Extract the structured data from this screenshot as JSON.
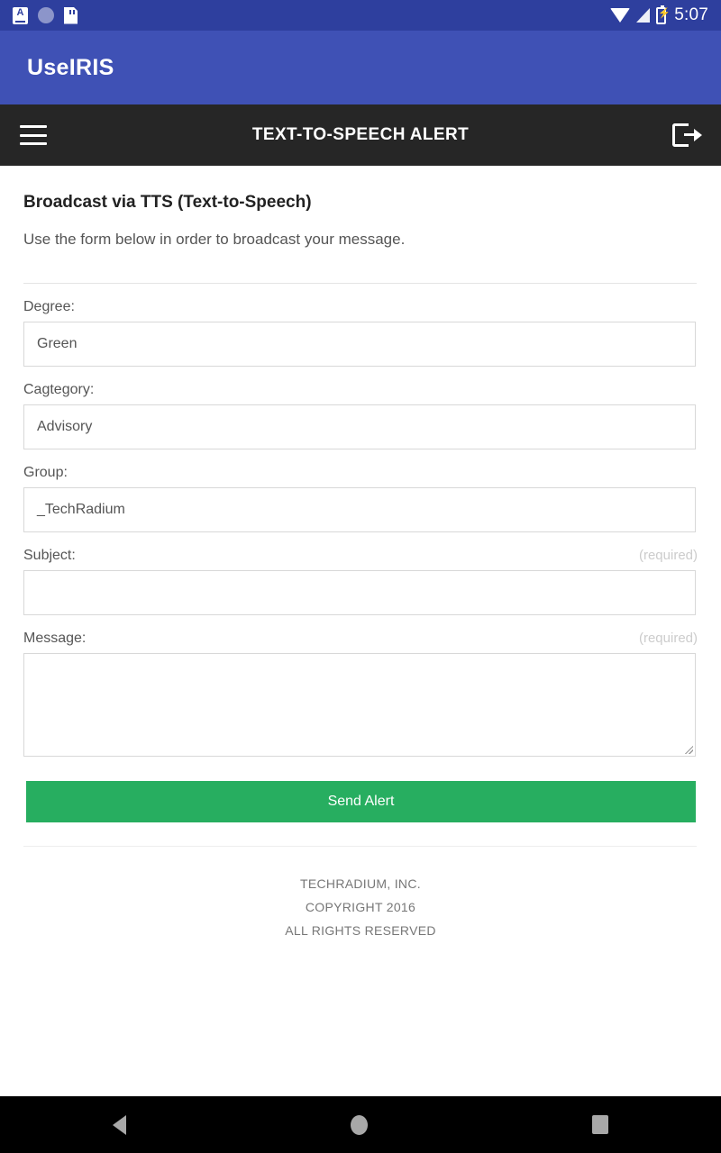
{
  "status_bar": {
    "time": "5:07",
    "left_icons": [
      "a-badge-icon",
      "circle-icon",
      "sdcard-icon"
    ],
    "right_icons": [
      "wifi-icon",
      "signal-icon",
      "battery-charging-icon"
    ],
    "background": "#2e3f9e"
  },
  "app_bar": {
    "title": "UseIRIS",
    "background": "#3f51b5"
  },
  "toolbar": {
    "title": "TEXT-TO-SPEECH ALERT",
    "menu_icon": "hamburger-menu-icon",
    "logout_icon": "logout-icon",
    "background": "#262626"
  },
  "main": {
    "heading": "Broadcast via TTS (Text-to-Speech)",
    "subtitle": "Use the form below in order to broadcast your message.",
    "fields": [
      {
        "label": "Degree:",
        "value": "Green",
        "required_tag": "",
        "type": "select"
      },
      {
        "label": "Cagtegory:",
        "value": "Advisory",
        "required_tag": "",
        "type": "select"
      },
      {
        "label": "Group:",
        "value": "_TechRadium",
        "required_tag": "",
        "type": "select"
      },
      {
        "label": "Subject:",
        "value": "",
        "required_tag": "(required)",
        "type": "input"
      },
      {
        "label": "Message:",
        "value": "",
        "required_tag": "(required)",
        "type": "textarea"
      }
    ],
    "submit_label": "Send Alert",
    "submit_color": "#27ae60"
  },
  "footer": {
    "line1": "TECHRADIUM, INC.",
    "line2": "COPYRIGHT 2016",
    "line3": "ALL RIGHTS RESERVED"
  },
  "nav_bar": {
    "back": "back-triangle-icon",
    "home": "home-circle-icon",
    "recents": "recents-square-icon"
  }
}
